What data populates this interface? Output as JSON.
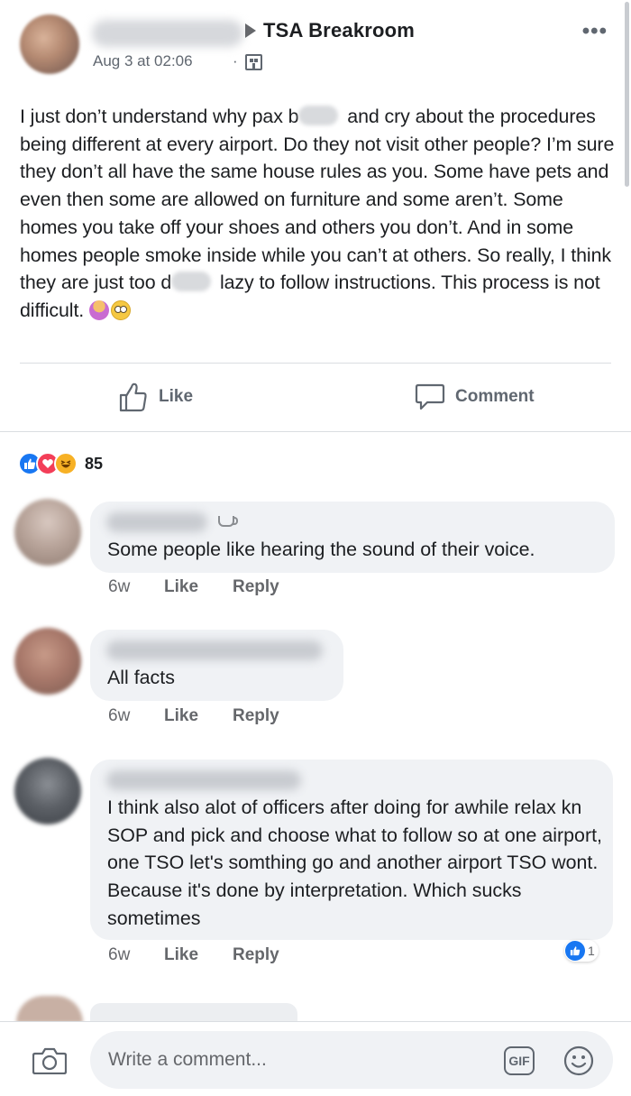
{
  "post": {
    "group_name": "TSA Breakroom",
    "timestamp": "Aug 3 at 02:06",
    "separator": "·",
    "more_glyph": "•••",
    "body_parts": [
      "I just don’t understand why pax b",
      " and cry about the procedures being different at every airport. Do they not visit other people? I’m sure they don’t all have the same house rules as you. Some have pets and even then some are allowed on furniture and some aren’t. Some homes you take off your shoes and others you don’t. And in some homes people smoke inside while you can’t at others. So really, I think they are just too d",
      " lazy to follow instructions. This process is not difficult. "
    ],
    "emojis": [
      "person-gesturing-emoji",
      "face-rolling-eyes-emoji"
    ]
  },
  "actions": {
    "like_label": "Like",
    "comment_label": "Comment"
  },
  "reactions": {
    "types": [
      "like",
      "love",
      "haha"
    ],
    "count": "85"
  },
  "comments": [
    {
      "text": "Some people like hearing the sound of their voice.",
      "time": "6w",
      "like": "Like",
      "reply": "Reply"
    },
    {
      "text": "All facts",
      "time": "6w",
      "like": "Like",
      "reply": "Reply"
    },
    {
      "text": "I think also alot of officers after doing for awhile relax kn SOP and pick and choose what to follow so at one airport, one TSO let's somthing go and another airport TSO wont. Because it's done by interpretation. Which sucks sometimes",
      "time": "6w",
      "like": "Like",
      "reply": "Reply",
      "reaction_count": "1"
    }
  ],
  "composer": {
    "placeholder": "Write a comment...",
    "gif_label": "GIF"
  },
  "colors": {
    "accent_blue": "#1877f2",
    "love_red": "#f33e58",
    "haha_yellow": "#f7b125",
    "bubble_bg": "#f0f2f5",
    "meta_gray": "#65676b"
  }
}
